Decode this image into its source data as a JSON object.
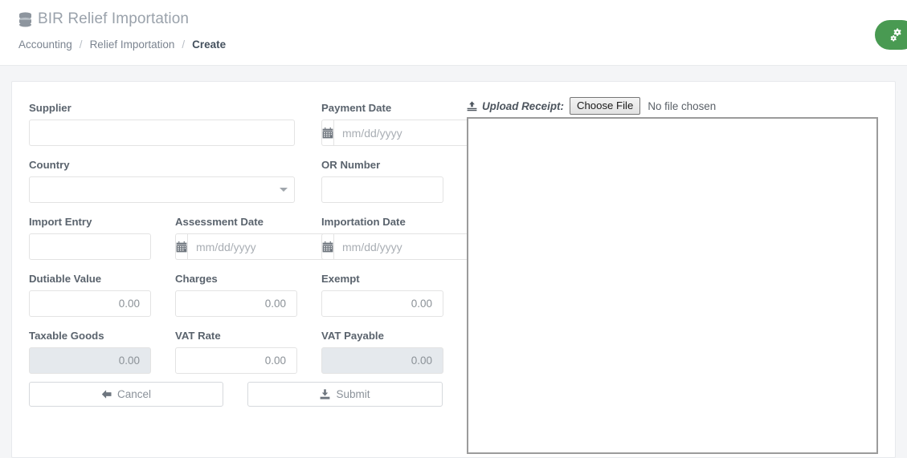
{
  "header": {
    "title": "BIR Relief Importation",
    "title_icon": "database-icon",
    "breadcrumb": [
      {
        "label": "Accounting",
        "active": false
      },
      {
        "label": "Relief Importation",
        "active": false
      },
      {
        "label": "Create",
        "active": true
      }
    ],
    "separator": "/",
    "settings_button": {
      "icon": "gears-icon",
      "color": "#499a52"
    }
  },
  "form": {
    "supplier": {
      "label": "Supplier",
      "value": "",
      "placeholder": ""
    },
    "country": {
      "label": "Country",
      "value": "",
      "arrow_icon": "caret-down-icon"
    },
    "import_entry": {
      "label": "Import Entry",
      "value": "",
      "placeholder": ""
    },
    "assessment_date": {
      "label": "Assessment Date",
      "value": "",
      "placeholder": "mm/dd/yyyy",
      "icon": "calendar-icon"
    },
    "payment_date": {
      "label": "Payment Date",
      "value": "",
      "placeholder": "mm/dd/yyyy",
      "icon": "calendar-icon"
    },
    "or_number": {
      "label": "OR Number",
      "value": "",
      "placeholder": ""
    },
    "importation_date": {
      "label": "Importation Date",
      "value": "",
      "placeholder": "mm/dd/yyyy",
      "icon": "calendar-icon"
    },
    "dutiable_value": {
      "label": "Dutiable Value",
      "value": "0.00",
      "disabled": false
    },
    "charges": {
      "label": "Charges",
      "value": "0.00",
      "disabled": false
    },
    "exempt": {
      "label": "Exempt",
      "value": "0.00",
      "disabled": false
    },
    "taxable_goods": {
      "label": "Taxable Goods",
      "value": "0.00",
      "disabled": true
    },
    "vat_rate": {
      "label": "VAT Rate",
      "value": "0.00",
      "disabled": false
    },
    "vat_payable": {
      "label": "VAT Payable",
      "value": "0.00",
      "disabled": true
    }
  },
  "actions": {
    "cancel": {
      "label": "Cancel",
      "icon": "arrow-left-icon"
    },
    "submit": {
      "label": "Submit",
      "icon": "download-icon"
    }
  },
  "upload": {
    "label": "Upload Receipt:",
    "icon": "upload-icon",
    "choose_file_label": "Choose File",
    "no_file_text": "No file chosen"
  }
}
